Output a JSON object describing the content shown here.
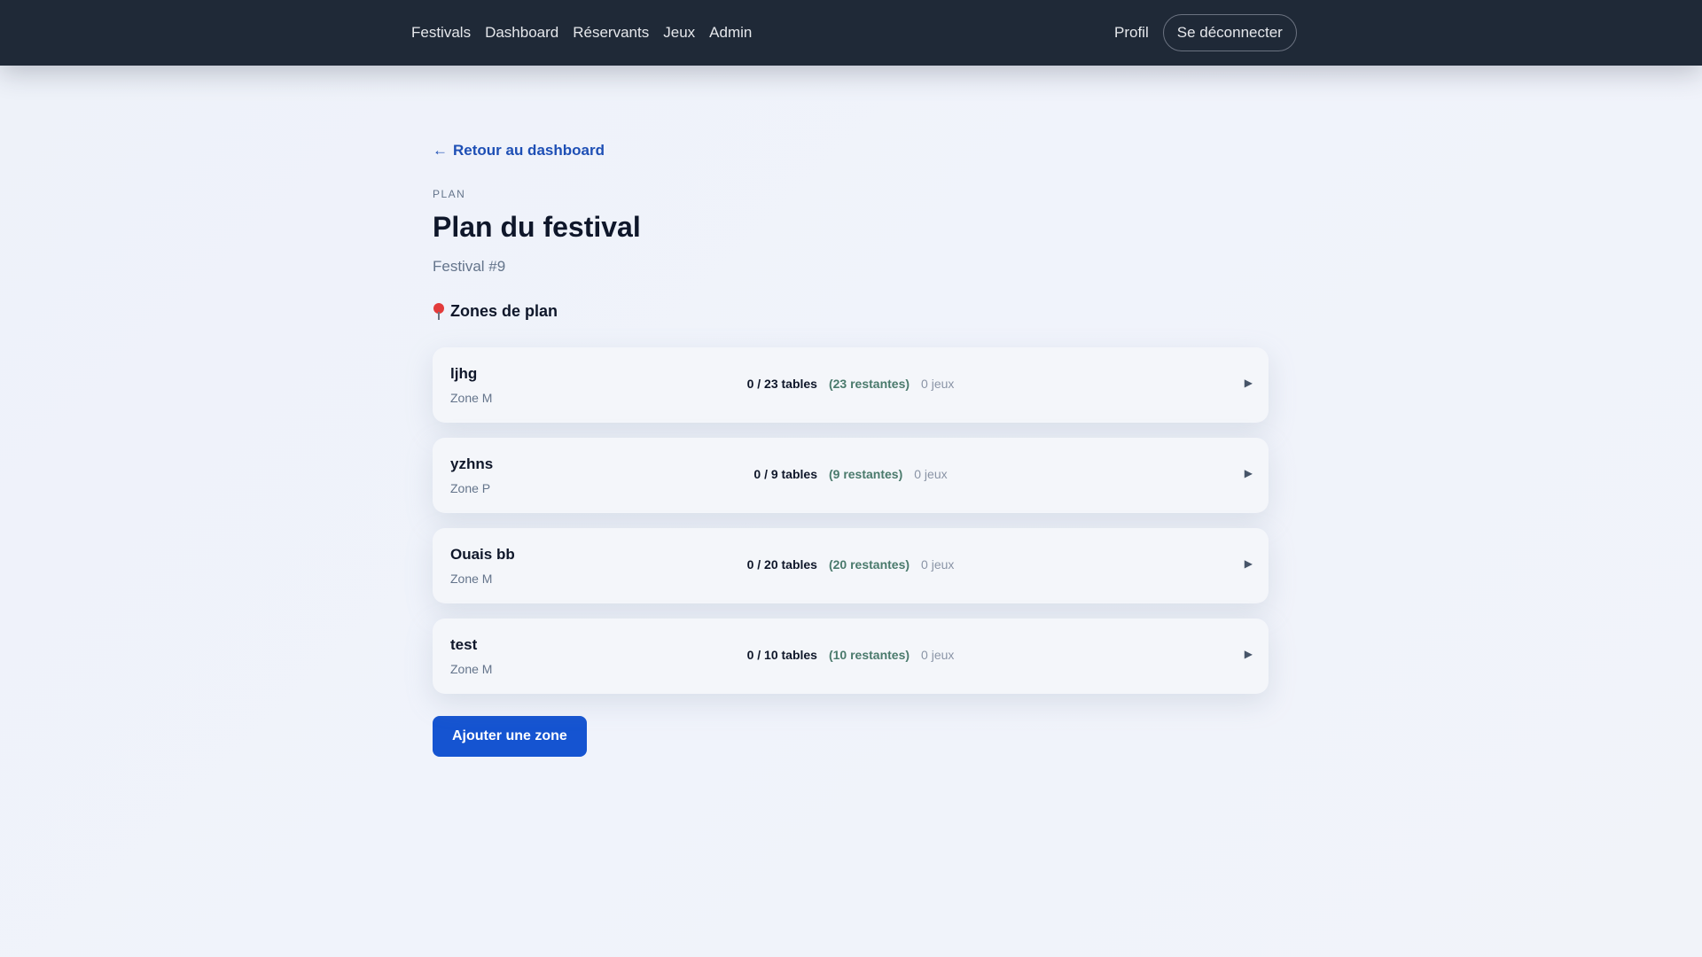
{
  "nav": {
    "links": [
      "Festivals",
      "Dashboard",
      "Réservants",
      "Jeux",
      "Admin"
    ],
    "profile": "Profil",
    "logout": "Se déconnecter"
  },
  "page": {
    "back_link": "Retour au dashboard",
    "eyebrow": "PLAN",
    "title": "Plan du festival",
    "subtitle": "Festival #9",
    "section_title": "Zones de plan",
    "add_button": "Ajouter une zone"
  },
  "zones": [
    {
      "name": "ljhg",
      "zone": "Zone M",
      "tables": "0 / 23 tables",
      "remaining": "(23 restantes)",
      "games": "0 jeux"
    },
    {
      "name": "yzhns",
      "zone": "Zone P",
      "tables": "0 / 9 tables",
      "remaining": "(9 restantes)",
      "games": "0 jeux"
    },
    {
      "name": "Ouais bb",
      "zone": "Zone M",
      "tables": "0 / 20 tables",
      "remaining": "(20 restantes)",
      "games": "0 jeux"
    },
    {
      "name": "test",
      "zone": "Zone M",
      "tables": "0 / 10 tables",
      "remaining": "(10 restantes)",
      "games": "0 jeux"
    }
  ],
  "icons": {
    "back": "arrow-left-icon",
    "section": "pin-icon",
    "expand": "triangle-right-icon"
  },
  "colors": {
    "navbar": "#1f2937",
    "link": "#1e4fb5",
    "primary_button": "#1554d1",
    "remaining": "#4a7a6c"
  }
}
